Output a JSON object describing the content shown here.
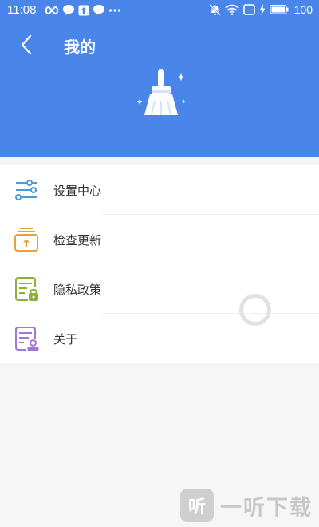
{
  "status_bar": {
    "time": "11:08",
    "battery": "100"
  },
  "header": {
    "title": "我的",
    "back_icon": "chevron-left-icon",
    "logo_icon": "broom-icon"
  },
  "menu": {
    "items": [
      {
        "label": "设置中心",
        "icon": "sliders-icon"
      },
      {
        "label": "检查更新",
        "icon": "update-icon"
      },
      {
        "label": "隐私政策",
        "icon": "privacy-lock-icon"
      },
      {
        "label": "关于",
        "icon": "about-document-icon"
      }
    ]
  },
  "watermark": {
    "badge": "听",
    "text": "一听下载"
  },
  "colors": {
    "header_bg": "#4a86ea",
    "page_bg": "#f6f6f6",
    "settings_icon": "#4a9bd6",
    "update_icon": "#e0a43c",
    "privacy_icon": "#8fae3e",
    "about_icon": "#a176d6"
  }
}
